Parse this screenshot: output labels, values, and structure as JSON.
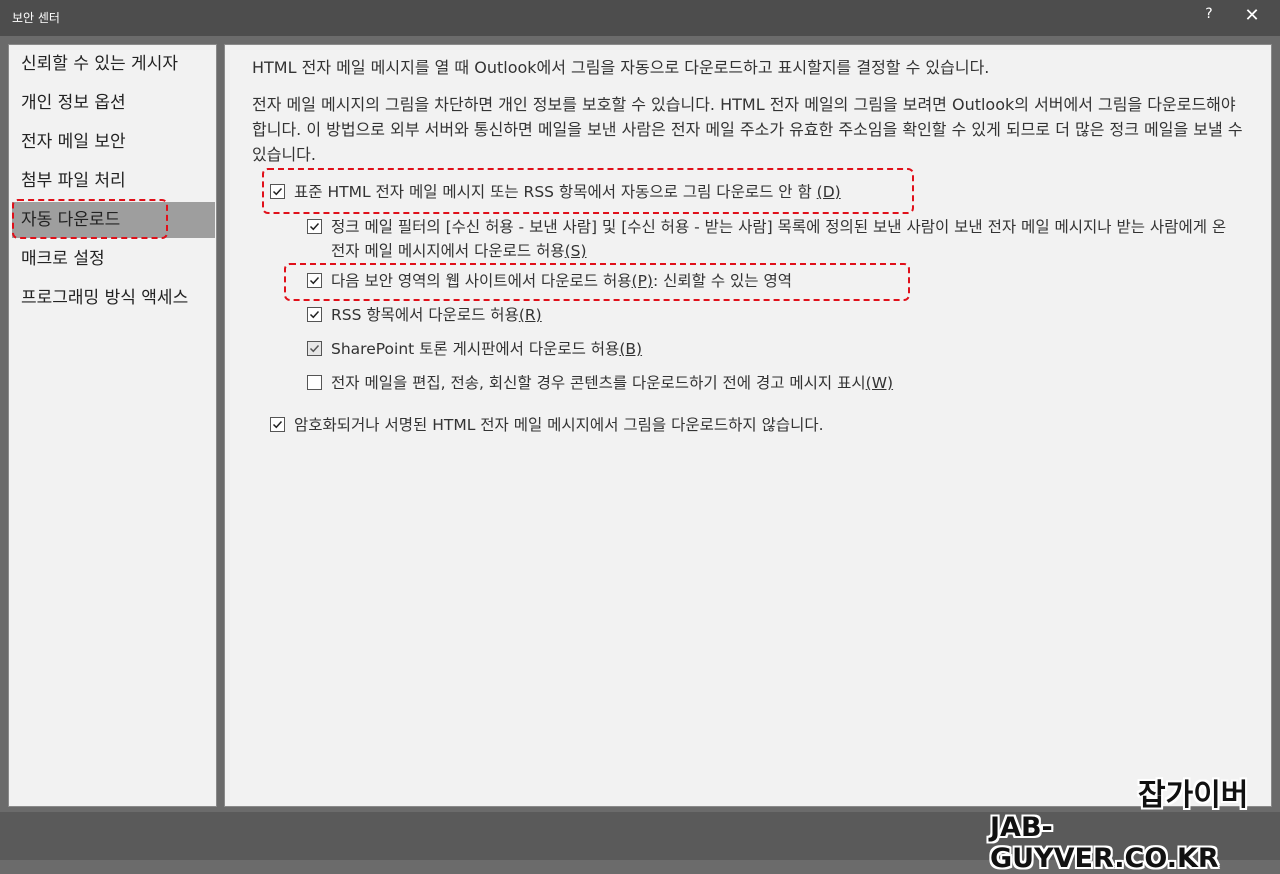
{
  "window": {
    "title": "보안 센터",
    "help_label": "?",
    "close_label": "✕"
  },
  "nav": {
    "items": [
      {
        "label": "신뢰할 수 있는 게시자"
      },
      {
        "label": "개인 정보 옵션"
      },
      {
        "label": "전자 메일 보안"
      },
      {
        "label": "첨부 파일 처리"
      },
      {
        "label": "자동 다운로드",
        "selected": true
      },
      {
        "label": "매크로 설정"
      },
      {
        "label": "프로그래밍 방식 액세스"
      }
    ]
  },
  "content": {
    "intro": "HTML 전자 메일 메시지를 열 때 Outlook에서 그림을 자동으로 다운로드하고 표시할지를 결정할 수 있습니다.",
    "description": "전자 메일 메시지의 그림을 차단하면 개인 정보를 보호할 수 있습니다. HTML 전자 메일의 그림을 보려면 Outlook의 서버에서 그림을 다운로드해야 합니다. 이 방법으로 외부 서버와 통신하면 메일을 보낸 사람은 전자 메일 주소가 유효한 주소임을 확인할 수 있게 되므로 더 많은 정크 메일을 보낼 수 있습니다.",
    "options": {
      "main": {
        "label": "표준 HTML 전자 메일 메시지 또는 RSS 항목에서 자동으로 그림 다운로드 안 함",
        "key": "(D)",
        "checked": true
      },
      "sub": [
        {
          "label": "정크 메일 필터의 [수신 허용 - 보낸 사람] 및 [수신 허용 - 받는 사람] 목록에 정의된 보낸 사람이 보낸 전자 메일 메시지나 받는 사람에게 온 전자 메일 메시지에서 다운로드 허용",
          "key": "(S)",
          "checked": true
        },
        {
          "label": "다음 보안 영역의 웹 사이트에서 다운로드 허용",
          "key": "(P)",
          "suffix": ": 신뢰할 수 있는 영역",
          "checked": true
        },
        {
          "label": "RSS 항목에서 다운로드 허용",
          "key": "(R)",
          "checked": true
        },
        {
          "label": "SharePoint 토론 게시판에서 다운로드 허용",
          "key": "(B)",
          "checked": true
        },
        {
          "label": "전자 메일을 편집, 전송, 회신할 경우 콘텐츠를 다운로드하기 전에 경고 메시지 표시",
          "key": "(W)",
          "checked": false
        }
      ],
      "encrypted": {
        "label": "암호화되거나 서명된 HTML 전자 메일 메시지에서 그림을 다운로드하지 않습니다.",
        "checked": true
      }
    }
  },
  "watermark": {
    "line1": "잡가이버",
    "line2": "JAB-GUYVER.CO.KR"
  },
  "colors": {
    "highlight": "#e0101a",
    "selected_nav": "#9e9e9e",
    "panel_bg": "#f2f2f2"
  }
}
